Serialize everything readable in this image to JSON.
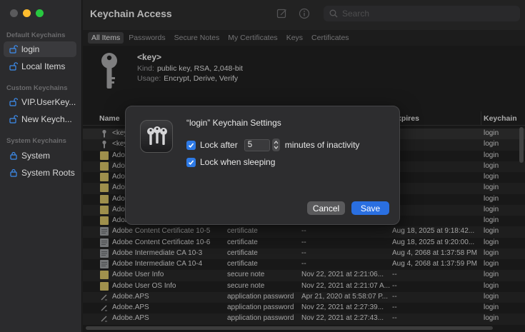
{
  "window": {
    "title": "Keychain Access"
  },
  "search": {
    "placeholder": "Search"
  },
  "sidebar": {
    "default_section": "Default Keychains",
    "custom_section": "Custom Keychains",
    "system_section": "System Keychains",
    "items": [
      {
        "label": "login",
        "icon": "unlocked-lock-icon"
      },
      {
        "label": "Local Items",
        "icon": "unlocked-lock-icon"
      },
      {
        "label": "VIP.UserKey...",
        "icon": "unlocked-lock-icon"
      },
      {
        "label": "New Keych...",
        "icon": "unlocked-lock-icon"
      },
      {
        "label": "System",
        "icon": "lock-icon"
      },
      {
        "label": "System Roots",
        "icon": "lock-icon"
      }
    ]
  },
  "tabs": [
    "All Items",
    "Passwords",
    "Secure Notes",
    "My Certificates",
    "Keys",
    "Certificates"
  ],
  "selected": {
    "name": "<key>",
    "kind_label": "Kind:",
    "kind": "public key, RSA, 2,048-bit",
    "usage_label": "Usage:",
    "usage": "Encrypt, Derive, Verify"
  },
  "table": {
    "headers": {
      "name": "Name",
      "expires": "Expires",
      "keychain": "Keychain"
    },
    "rows": [
      {
        "icon": "key",
        "name": "<key>",
        "kind": "",
        "date": "",
        "expires": "",
        "keychain": "login"
      },
      {
        "icon": "key",
        "name": "<key>",
        "kind": "",
        "date": "",
        "expires": "",
        "keychain": "login"
      },
      {
        "icon": "note",
        "name": "Adobe",
        "kind": "",
        "date": "",
        "expires": "",
        "keychain": "login"
      },
      {
        "icon": "note",
        "name": "Adobe",
        "kind": "",
        "date": "",
        "expires": "",
        "keychain": "login"
      },
      {
        "icon": "note",
        "name": "Adobe",
        "kind": "",
        "date": "",
        "expires": "",
        "keychain": "login"
      },
      {
        "icon": "note",
        "name": "Adobe",
        "kind": "",
        "date": "",
        "expires": "",
        "keychain": "login"
      },
      {
        "icon": "note",
        "name": "Adobe",
        "kind": "",
        "date": "",
        "expires": "",
        "keychain": "login"
      },
      {
        "icon": "note",
        "name": "Adobe",
        "kind": "",
        "date": "",
        "expires": "",
        "keychain": "login"
      },
      {
        "icon": "note",
        "name": "Adobe",
        "kind": "",
        "date": "",
        "expires": "",
        "keychain": "login"
      },
      {
        "icon": "cert",
        "name": "Adobe Content Certificate 10-5",
        "kind": "certificate",
        "date": "--",
        "expires": "Aug 18, 2025 at 9:18:42...",
        "keychain": "login"
      },
      {
        "icon": "cert",
        "name": "Adobe Content Certificate 10-6",
        "kind": "certificate",
        "date": "--",
        "expires": "Aug 18, 2025 at 9:20:00...",
        "keychain": "login"
      },
      {
        "icon": "cert",
        "name": "Adobe Intermediate CA 10-3",
        "kind": "certificate",
        "date": "--",
        "expires": "Aug 4, 2068 at 1:37:58 PM",
        "keychain": "login"
      },
      {
        "icon": "cert",
        "name": "Adobe Intermediate CA 10-4",
        "kind": "certificate",
        "date": "--",
        "expires": "Aug 4, 2068 at 1:37:59 PM",
        "keychain": "login"
      },
      {
        "icon": "note",
        "name": "Adobe User Info",
        "kind": "secure note",
        "date": "Nov 22, 2021 at 2:21:06...",
        "expires": "--",
        "keychain": "login"
      },
      {
        "icon": "note",
        "name": "Adobe User OS Info",
        "kind": "secure note",
        "date": "Nov 22, 2021 at 2:21:07 A...",
        "expires": "--",
        "keychain": "login"
      },
      {
        "icon": "pwd",
        "name": "Adobe.APS",
        "kind": "application password",
        "date": "Apr 21, 2020 at 5:58:07 P...",
        "expires": "--",
        "keychain": "login"
      },
      {
        "icon": "pwd",
        "name": "Adobe.APS",
        "kind": "application password",
        "date": "Nov 22, 2021 at 2:27:39...",
        "expires": "--",
        "keychain": "login"
      },
      {
        "icon": "pwd",
        "name": "Adobe.APS",
        "kind": "application password",
        "date": "Nov 22, 2021 at 2:27:43...",
        "expires": "--",
        "keychain": "login"
      }
    ]
  },
  "dialog": {
    "title": "“login” Keychain Settings",
    "lock_after_label": "Lock after",
    "lock_after_value": "5",
    "minutes_label": "minutes of inactivity",
    "lock_sleep_label": "Lock when sleeping",
    "lock_after_checked": true,
    "lock_sleep_checked": true,
    "cancel_label": "Cancel",
    "save_label": "Save"
  },
  "colors": {
    "accent": "#2a6fe0",
    "checkbox": "#2e7ae6"
  }
}
